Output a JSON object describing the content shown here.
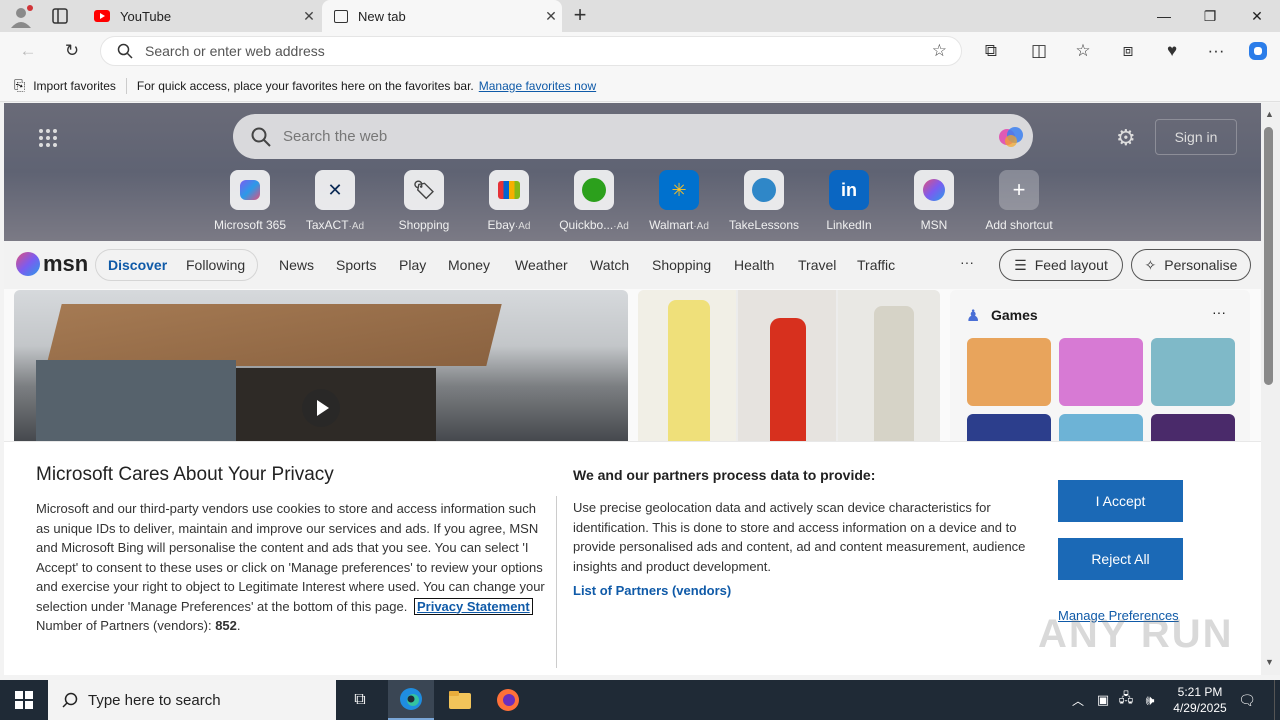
{
  "browser": {
    "tabs": [
      {
        "label": "YouTube",
        "icon": "youtube-icon",
        "active": false
      },
      {
        "label": "New tab",
        "icon": "newtab-icon",
        "active": true
      }
    ],
    "address_placeholder": "Search or enter web address"
  },
  "favorites_bar": {
    "import_label": "Import favorites",
    "hint": "For quick access, place your favorites here on the favorites bar.",
    "manage_link": "Manage favorites now"
  },
  "newtab": {
    "search_placeholder": "Search the web",
    "sign_in": "Sign in",
    "shortcuts": [
      {
        "label": "Microsoft 365",
        "ad": ""
      },
      {
        "label": "TaxACT",
        "ad": "Ad"
      },
      {
        "label": "Shopping",
        "ad": ""
      },
      {
        "label": "Ebay",
        "ad": "Ad"
      },
      {
        "label": "Quickbo...",
        "ad": "Ad"
      },
      {
        "label": "Walmart",
        "ad": "Ad"
      },
      {
        "label": "TakeLessons",
        "ad": ""
      },
      {
        "label": "LinkedIn",
        "ad": ""
      },
      {
        "label": "MSN",
        "ad": ""
      },
      {
        "label": "Add shortcut",
        "ad": ""
      }
    ],
    "ad_sep": "·"
  },
  "msn": {
    "logo": "msn",
    "tabs": [
      "Discover",
      "Following"
    ],
    "nav": [
      "News",
      "Sports",
      "Play",
      "Money",
      "Weather",
      "Watch",
      "Shopping",
      "Health",
      "Travel",
      "Traffic"
    ],
    "more": "···",
    "feed_layout": "Feed layout",
    "personalise": "Personalise",
    "games_title": "Games",
    "games_more": "···"
  },
  "consent": {
    "title": "Microsoft Cares About Your Privacy",
    "body": "Microsoft and our third-party vendors use cookies to store and access information such as unique IDs to deliver, maintain and improve our services and ads. If you agree, MSN and Microsoft Bing will personalise the content and ads that you see. You can select 'I Accept' to consent to these uses or click on 'Manage preferences' to review your options and exercise your right to object to Legitimate Interest where used. You can change your selection under 'Manage Preferences' at the bottom of this page.",
    "privacy_link": "Privacy Statement",
    "partners_label": "Number of Partners (vendors):",
    "partners_count": "852",
    "process_title": "We and our partners process data to provide:",
    "process_body": "Use precise geolocation data and actively scan device characteristics for identification. This is done to store and access information on a device and to provide personalised ads and content, ad and content measurement, audience insights and product development.",
    "partners_link": "List of Partners (vendors)",
    "accept": "I Accept",
    "reject": "Reject All",
    "manage": "Manage Preferences"
  },
  "taskbar": {
    "search_placeholder": "Type here to search",
    "time": "5:21 PM",
    "date": "4/29/2025"
  },
  "watermark": "ANY RUN",
  "colors": {
    "accent": "#1b69b6",
    "link": "#0f5aa8",
    "taskbar": "#1f2a36"
  }
}
